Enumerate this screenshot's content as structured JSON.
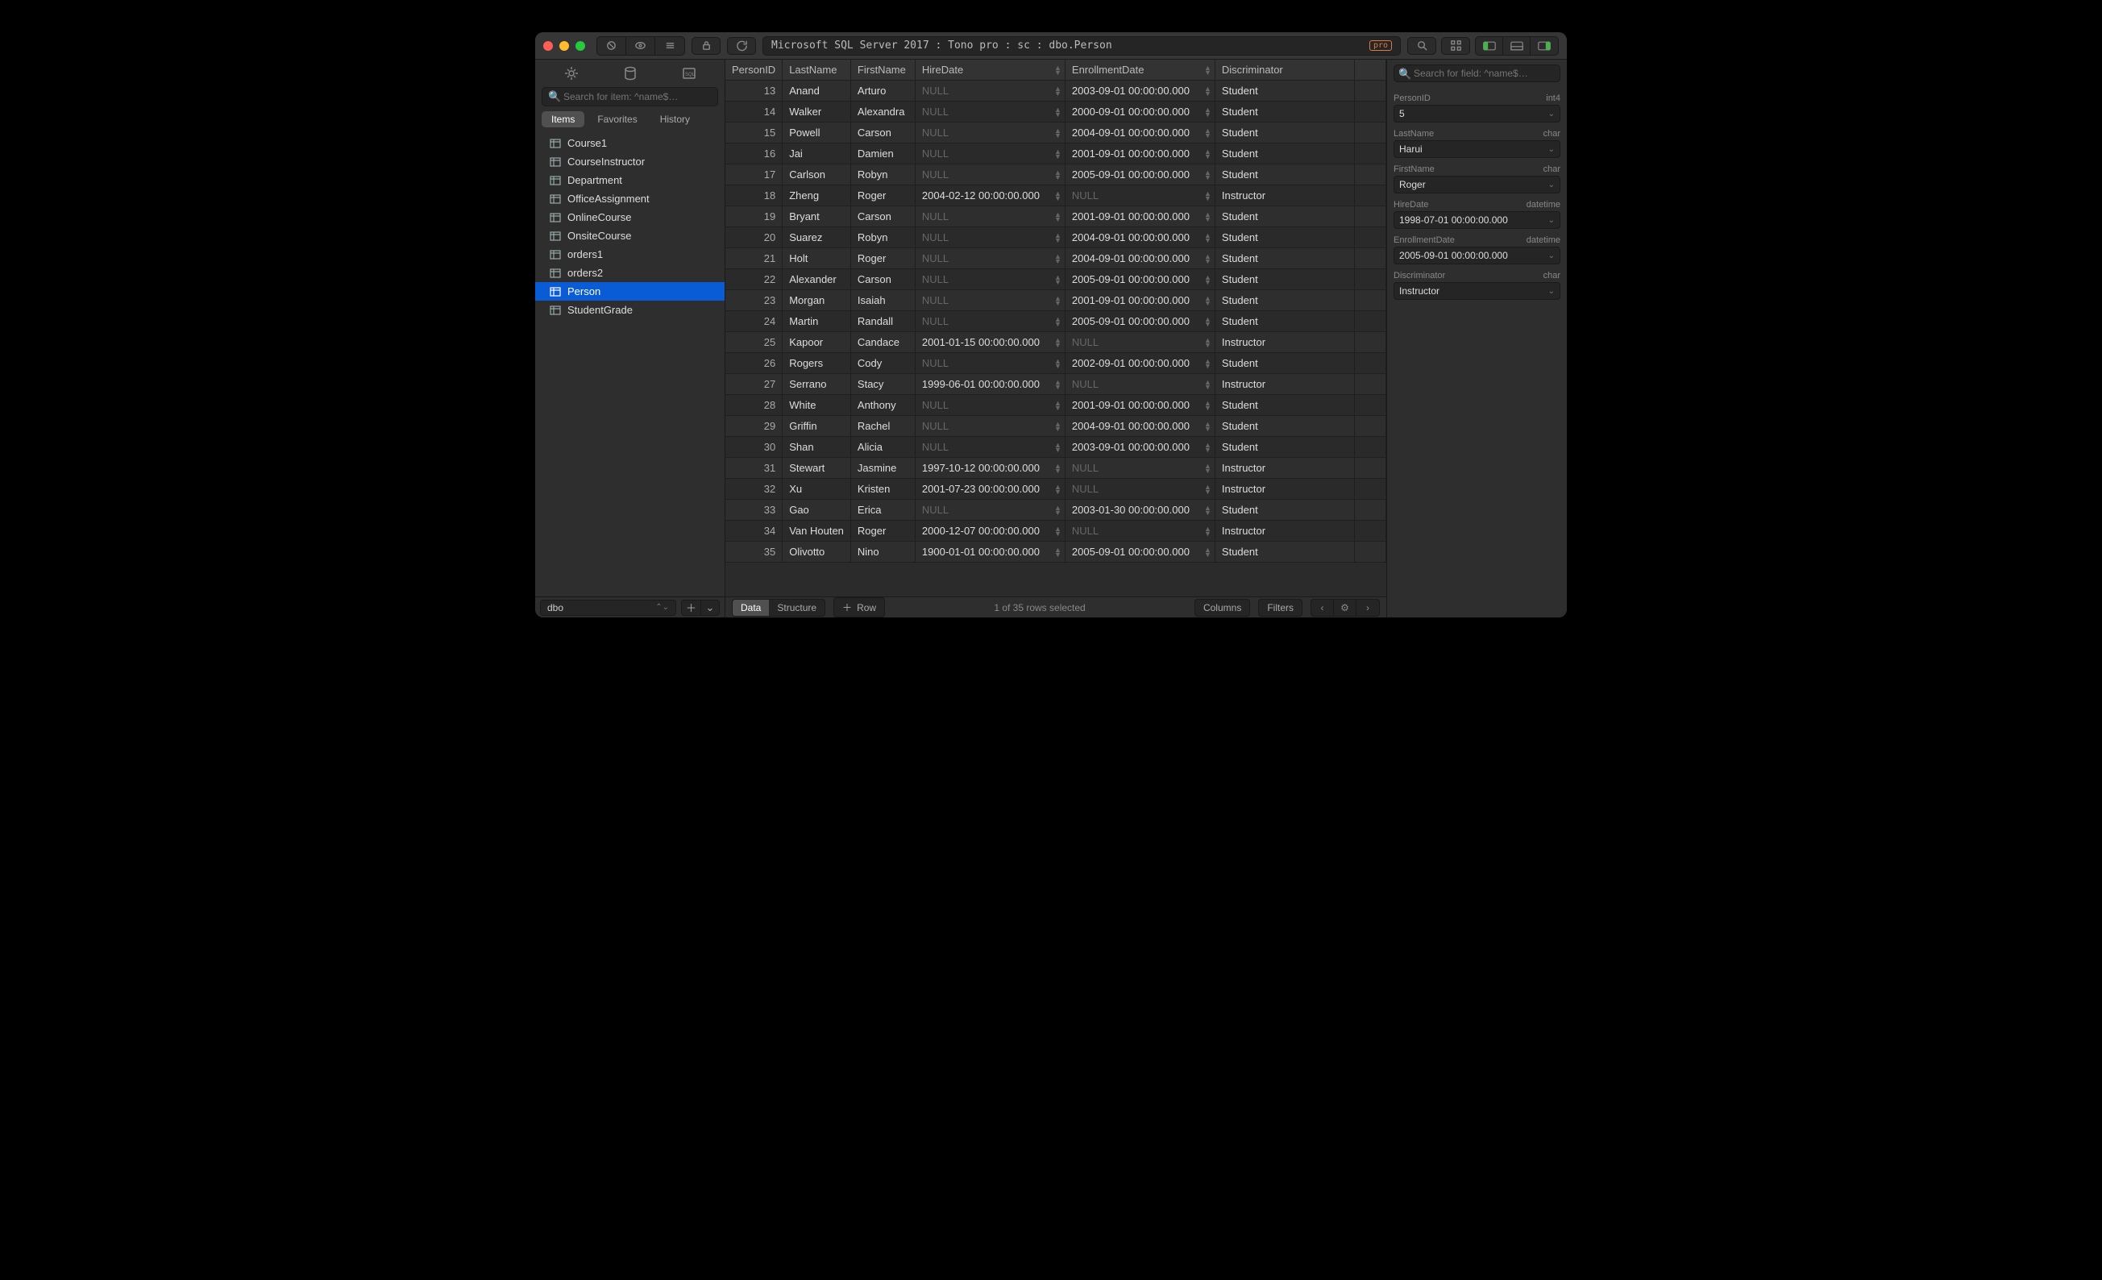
{
  "titlebar": {
    "path": "Microsoft SQL Server 2017 : Tono pro : sc : dbo.Person",
    "badge": "pro"
  },
  "sidebar": {
    "search_placeholder": "Search for item: ^name$…",
    "filter_tabs": [
      "Items",
      "Favorites",
      "History"
    ],
    "filter_active": 0,
    "tables": [
      "Course1",
      "CourseInstructor",
      "Department",
      "OfficeAssignment",
      "OnlineCourse",
      "OnsiteCourse",
      "orders1",
      "orders2",
      "Person",
      "StudentGrade"
    ],
    "selected_table": "Person",
    "schema": "dbo"
  },
  "grid": {
    "columns": [
      "PersonID",
      "LastName",
      "FirstName",
      "HireDate",
      "EnrollmentDate",
      "Discriminator"
    ],
    "rows": [
      {
        "id": "13",
        "last": "Anand",
        "first": "Arturo",
        "hire": null,
        "enroll": "2003-09-01 00:00:00.000",
        "disc": "Student"
      },
      {
        "id": "14",
        "last": "Walker",
        "first": "Alexandra",
        "hire": null,
        "enroll": "2000-09-01 00:00:00.000",
        "disc": "Student"
      },
      {
        "id": "15",
        "last": "Powell",
        "first": "Carson",
        "hire": null,
        "enroll": "2004-09-01 00:00:00.000",
        "disc": "Student"
      },
      {
        "id": "16",
        "last": "Jai",
        "first": "Damien",
        "hire": null,
        "enroll": "2001-09-01 00:00:00.000",
        "disc": "Student"
      },
      {
        "id": "17",
        "last": "Carlson",
        "first": "Robyn",
        "hire": null,
        "enroll": "2005-09-01 00:00:00.000",
        "disc": "Student"
      },
      {
        "id": "18",
        "last": "Zheng",
        "first": "Roger",
        "hire": "2004-02-12 00:00:00.000",
        "enroll": null,
        "disc": "Instructor"
      },
      {
        "id": "19",
        "last": "Bryant",
        "first": "Carson",
        "hire": null,
        "enroll": "2001-09-01 00:00:00.000",
        "disc": "Student"
      },
      {
        "id": "20",
        "last": "Suarez",
        "first": "Robyn",
        "hire": null,
        "enroll": "2004-09-01 00:00:00.000",
        "disc": "Student"
      },
      {
        "id": "21",
        "last": "Holt",
        "first": "Roger",
        "hire": null,
        "enroll": "2004-09-01 00:00:00.000",
        "disc": "Student"
      },
      {
        "id": "22",
        "last": "Alexander",
        "first": "Carson",
        "hire": null,
        "enroll": "2005-09-01 00:00:00.000",
        "disc": "Student"
      },
      {
        "id": "23",
        "last": "Morgan",
        "first": "Isaiah",
        "hire": null,
        "enroll": "2001-09-01 00:00:00.000",
        "disc": "Student"
      },
      {
        "id": "24",
        "last": "Martin",
        "first": "Randall",
        "hire": null,
        "enroll": "2005-09-01 00:00:00.000",
        "disc": "Student"
      },
      {
        "id": "25",
        "last": "Kapoor",
        "first": "Candace",
        "hire": "2001-01-15 00:00:00.000",
        "enroll": null,
        "disc": "Instructor"
      },
      {
        "id": "26",
        "last": "Rogers",
        "first": "Cody",
        "hire": null,
        "enroll": "2002-09-01 00:00:00.000",
        "disc": "Student"
      },
      {
        "id": "27",
        "last": "Serrano",
        "first": "Stacy",
        "hire": "1999-06-01 00:00:00.000",
        "enroll": null,
        "disc": "Instructor"
      },
      {
        "id": "28",
        "last": "White",
        "first": "Anthony",
        "hire": null,
        "enroll": "2001-09-01 00:00:00.000",
        "disc": "Student"
      },
      {
        "id": "29",
        "last": "Griffin",
        "first": "Rachel",
        "hire": null,
        "enroll": "2004-09-01 00:00:00.000",
        "disc": "Student"
      },
      {
        "id": "30",
        "last": "Shan",
        "first": "Alicia",
        "hire": null,
        "enroll": "2003-09-01 00:00:00.000",
        "disc": "Student"
      },
      {
        "id": "31",
        "last": "Stewart",
        "first": "Jasmine",
        "hire": "1997-10-12 00:00:00.000",
        "enroll": null,
        "disc": "Instructor"
      },
      {
        "id": "32",
        "last": "Xu",
        "first": "Kristen",
        "hire": "2001-07-23 00:00:00.000",
        "enroll": null,
        "disc": "Instructor"
      },
      {
        "id": "33",
        "last": "Gao",
        "first": "Erica",
        "hire": null,
        "enroll": "2003-01-30 00:00:00.000",
        "disc": "Student"
      },
      {
        "id": "34",
        "last": "Van Houten",
        "first": "Roger",
        "hire": "2000-12-07 00:00:00.000",
        "enroll": null,
        "disc": "Instructor"
      },
      {
        "id": "35",
        "last": "Olivotto",
        "first": "Nino",
        "hire": "1900-01-01 00:00:00.000",
        "enroll": "2005-09-01 00:00:00.000",
        "disc": "Student"
      }
    ],
    "null_label": "NULL"
  },
  "footer": {
    "views": [
      "Data",
      "Structure"
    ],
    "view_active": 0,
    "add_row_label": "Row",
    "status": "1 of 35 rows selected",
    "columns_btn": "Columns",
    "filters_btn": "Filters"
  },
  "inspector": {
    "search_placeholder": "Search for field: ^name$…",
    "fields": [
      {
        "name": "PersonID",
        "type": "int4",
        "value": "5"
      },
      {
        "name": "LastName",
        "type": "char",
        "value": "Harui"
      },
      {
        "name": "FirstName",
        "type": "char",
        "value": "Roger"
      },
      {
        "name": "HireDate",
        "type": "datetime",
        "value": "1998-07-01 00:00:00.000"
      },
      {
        "name": "EnrollmentDate",
        "type": "datetime",
        "value": "2005-09-01 00:00:00.000"
      },
      {
        "name": "Discriminator",
        "type": "char",
        "value": "Instructor"
      }
    ]
  }
}
